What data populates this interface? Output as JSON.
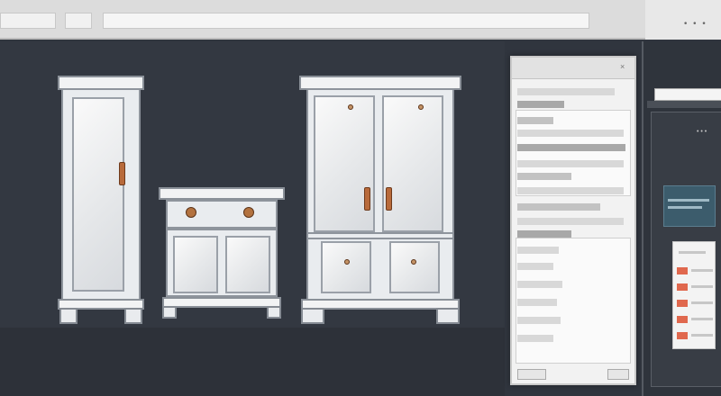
{
  "toolbar": {
    "dots_label": "• • •"
  },
  "properties_panel": {
    "close_label": "×"
  },
  "dock": {
    "panel_label": "• • •"
  },
  "colors": {
    "accent_handle": "#b86a3b",
    "teal_card": "#3c5c6c",
    "list_marker": "#e0684e",
    "canvas_bg": "#333841"
  },
  "icons": [
    "close-icon",
    "more-icon"
  ]
}
